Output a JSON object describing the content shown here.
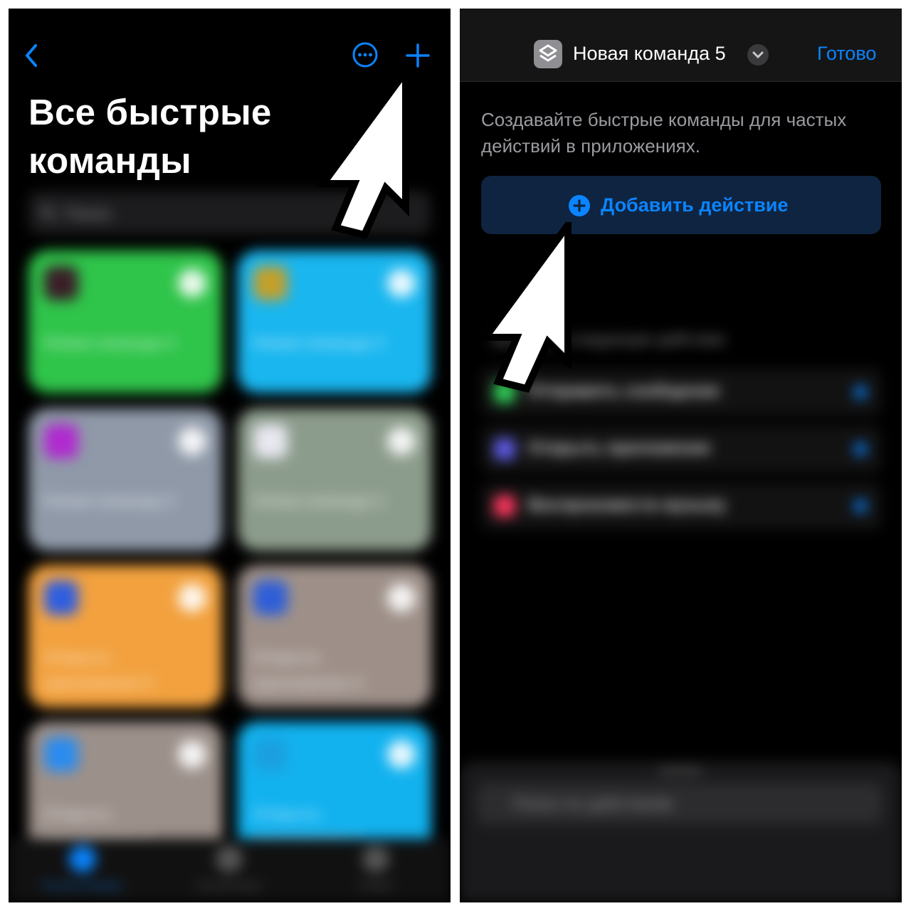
{
  "left": {
    "title": "Все быстрые команды",
    "search_placeholder": "Поиск",
    "tiles": [
      {
        "label": "Новая команда 4",
        "color": "#2fc44a",
        "app_color": "#3a1f28"
      },
      {
        "label": "Новая команда 3",
        "color": "#19b6ef",
        "app_color": "#c4a02a"
      },
      {
        "label": "Новая команда 2",
        "color": "#8f99a8",
        "app_color": "#b02ad0"
      },
      {
        "label": "Новая команда 1",
        "color": "#8c9c8c",
        "app_color": "#e8e8f0"
      },
      {
        "label": "Открыть приложение 5",
        "color": "#f2a13e",
        "app_color": "#2f5ee0"
      },
      {
        "label": "Открыть приложение 4",
        "color": "#9e9089",
        "app_color": "#2e5ed8"
      },
      {
        "label": "Открыть приложение 3",
        "color": "#9c908a",
        "app_color": "#2a8cf0"
      },
      {
        "label": "Открыть приложение 2",
        "color": "#12b2ef",
        "app_color": "#1aa0e0"
      }
    ],
    "tabs": [
      {
        "label": "Быстрые команды",
        "color": "#0a84ff"
      },
      {
        "label": "Автоматизация",
        "color": "#555"
      },
      {
        "label": "Галерея",
        "color": "#555"
      }
    ],
    "icons": {
      "back": "chevron-left-icon",
      "more": "ellipsis-circle-icon",
      "add": "plus-icon"
    },
    "accent": "#0a84ff"
  },
  "right": {
    "title": "Новая команда 5",
    "done_label": "Готово",
    "description": "Создавайте быстрые команды для частых действий в приложениях.",
    "add_action_label": "Добавить действие",
    "suggestions_header": "Выберите следующее действие",
    "suggestions": [
      {
        "label": "Отправить сообщение",
        "icon_color": "#30d158"
      },
      {
        "label": "Открыть приложение",
        "icon_color": "#5e5ce6"
      },
      {
        "label": "Воспроизвести музыку",
        "icon_color": "#ff375f"
      }
    ],
    "search_placeholder": "Поиск по действиям",
    "accent": "#0a84ff"
  }
}
